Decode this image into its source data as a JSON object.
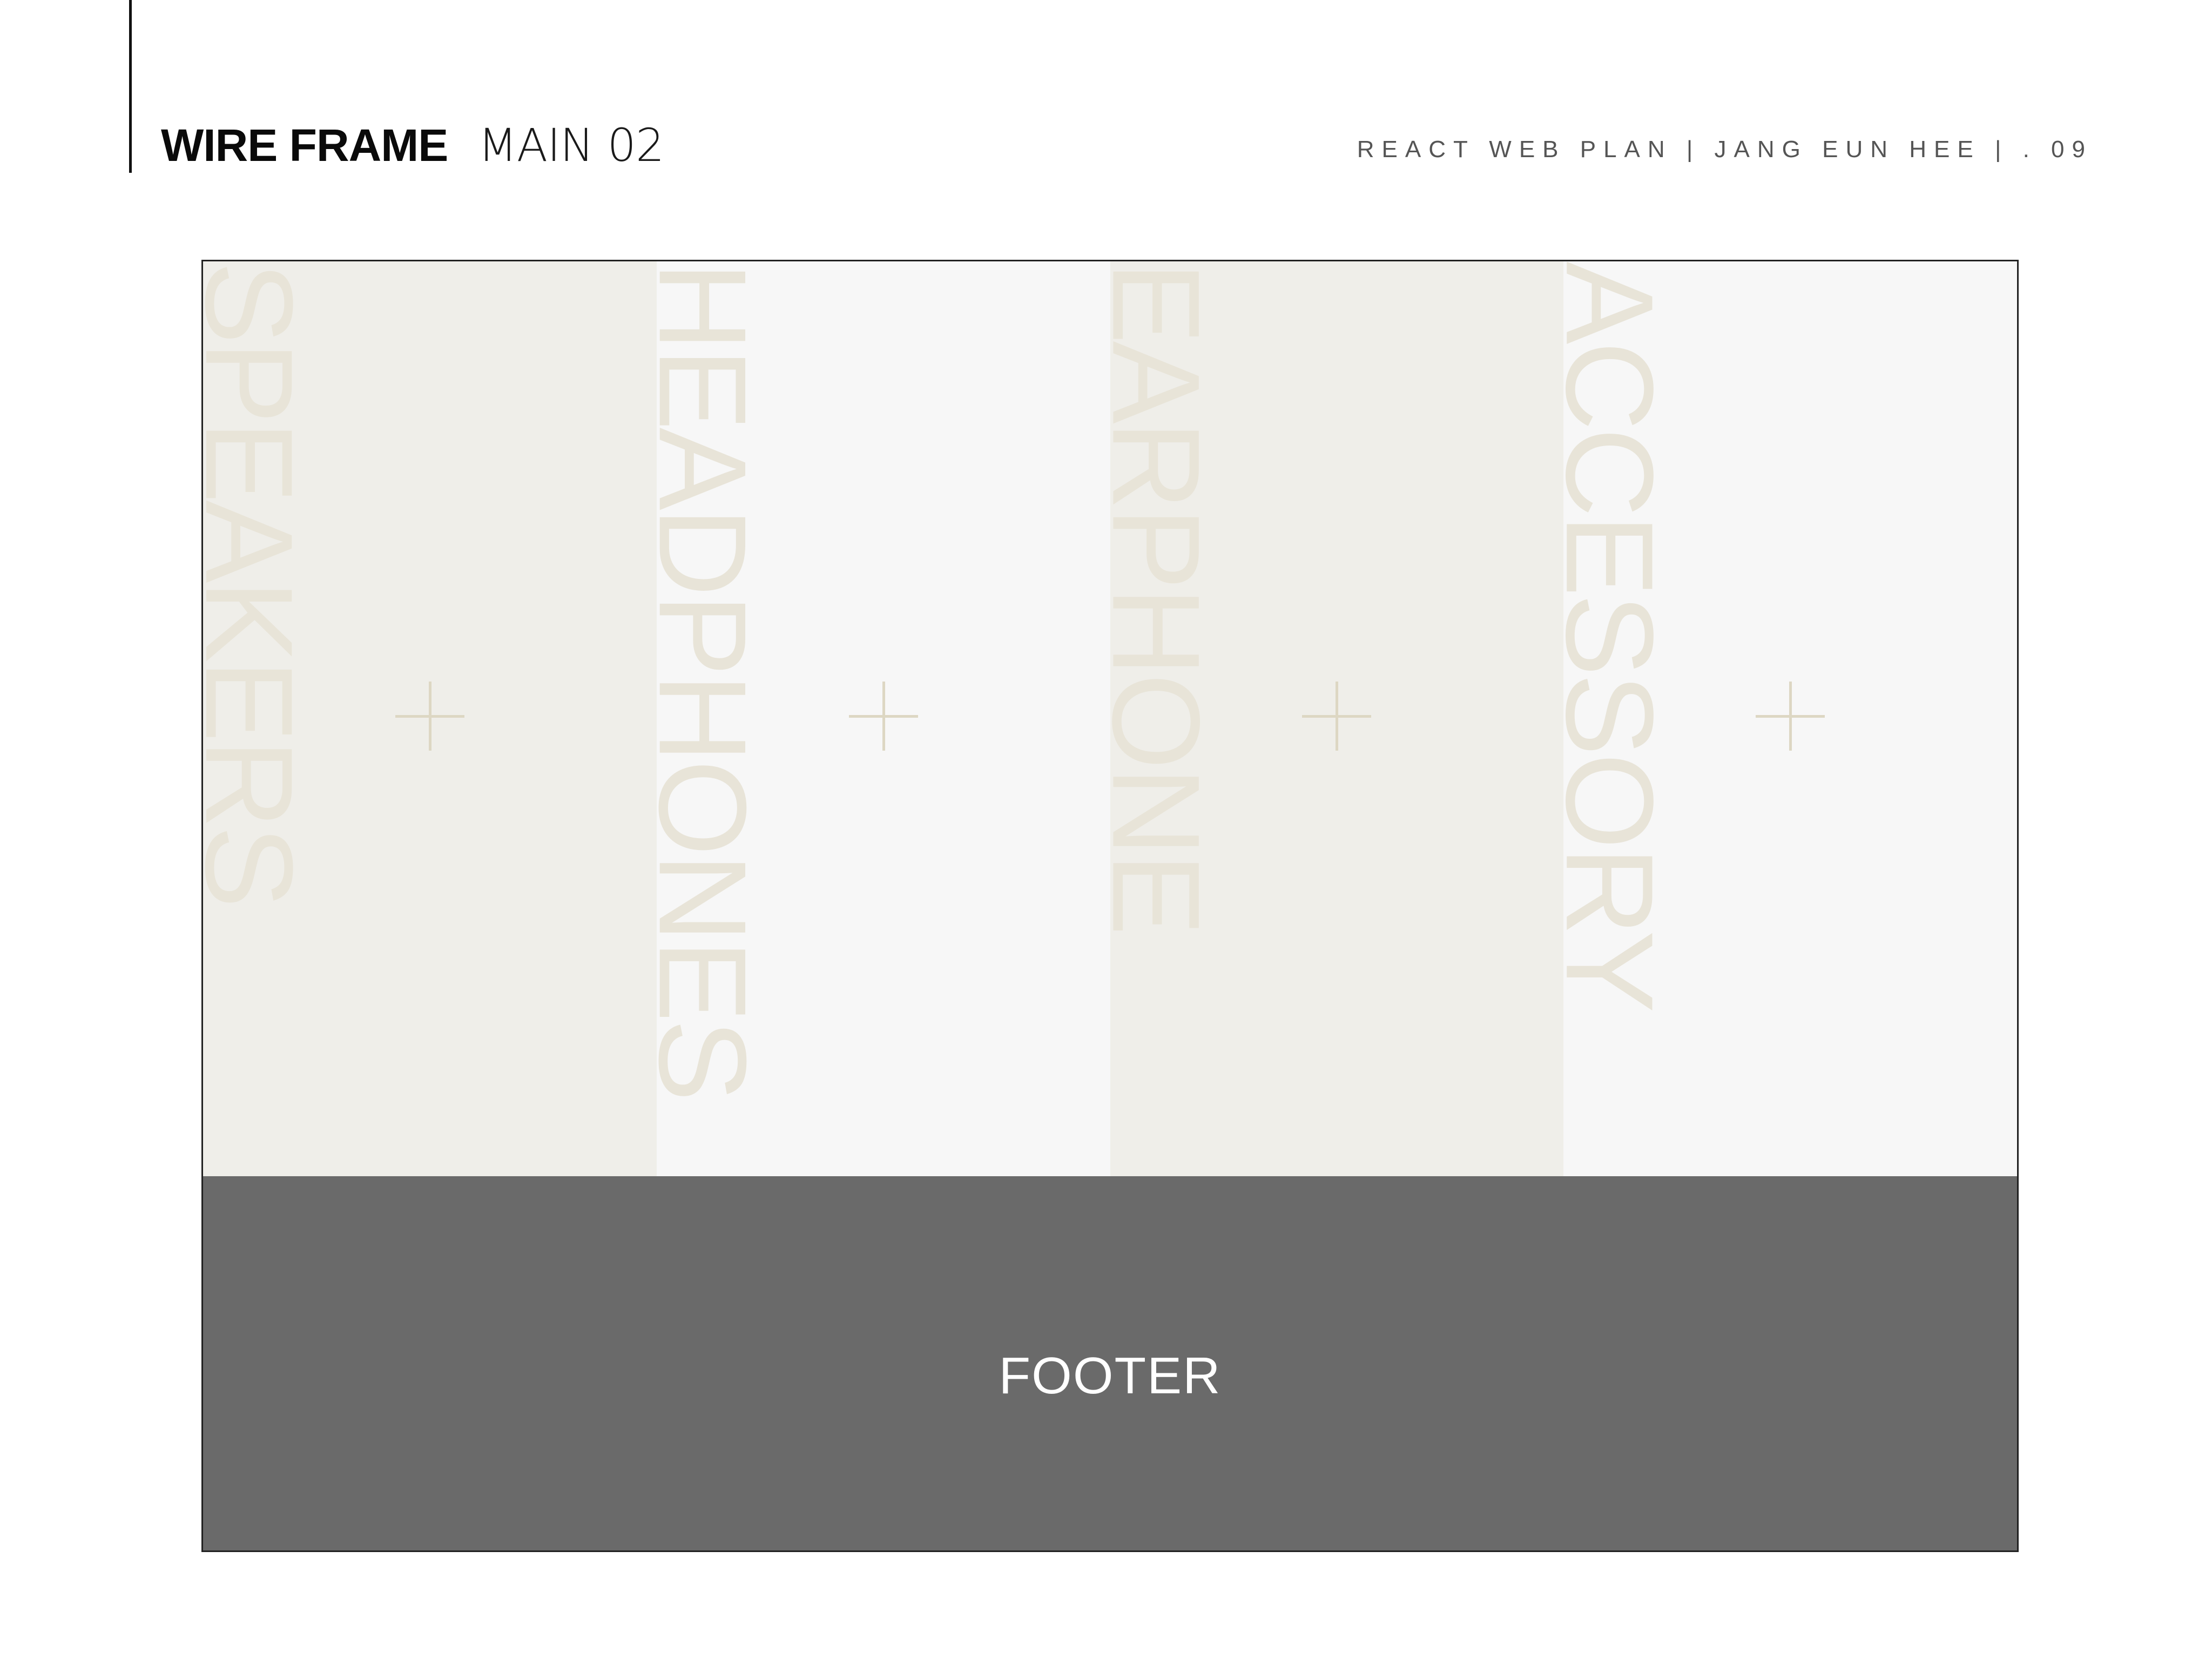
{
  "header": {
    "title": "WIRE FRAME",
    "subtitle": "MAIN 02",
    "meta": "REACT WEB PLAN  |  JANG EUN HEE  | . 09"
  },
  "wireframe": {
    "columns": [
      {
        "label": "SPEAKERS",
        "icon": "plus-icon"
      },
      {
        "label": "HEADPHONES",
        "icon": "plus-icon"
      },
      {
        "label": "EARPHONE",
        "icon": "plus-icon"
      },
      {
        "label": "ACCESSORY",
        "icon": "plus-icon"
      }
    ],
    "footer_label": "FOOTER"
  },
  "colors": {
    "column_tone_a": "#efeee9",
    "column_tone_b": "#f7f7f7",
    "label_color": "#e8e4d8",
    "plus_color": "#ddd7c3",
    "footer_bg": "#6a6a6a",
    "footer_text": "#ffffff"
  }
}
